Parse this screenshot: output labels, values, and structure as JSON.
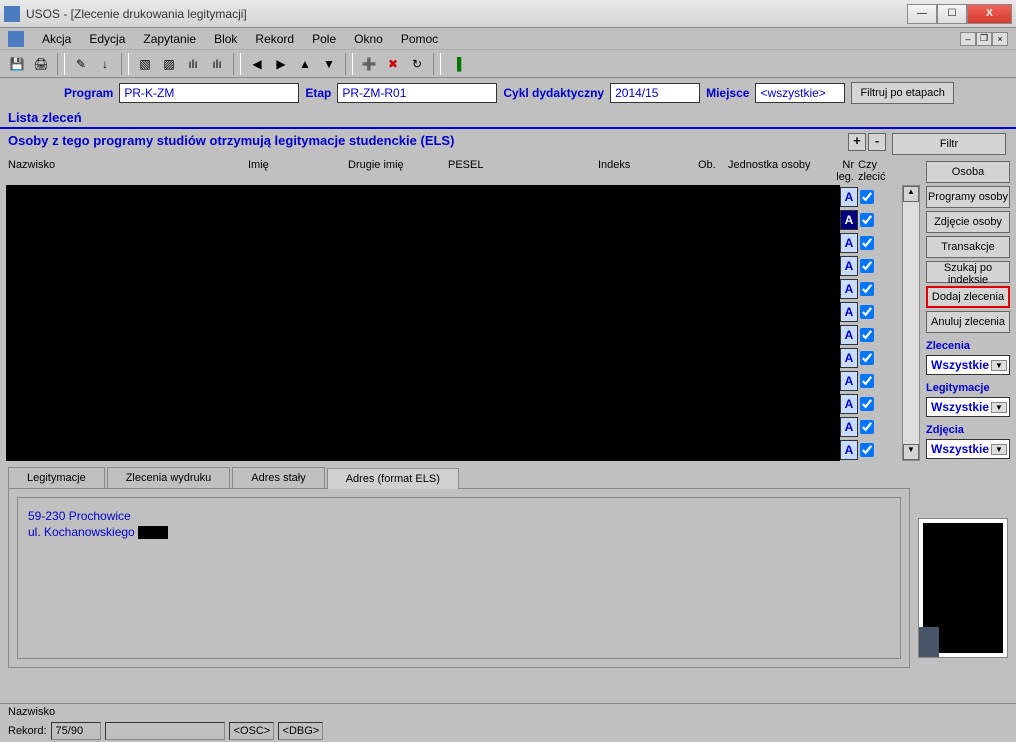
{
  "window": {
    "title": "USOS - [Zlecenie drukowania legitymacji]"
  },
  "menu": {
    "items": [
      "Akcja",
      "Edycja",
      "Zapytanie",
      "Blok",
      "Rekord",
      "Pole",
      "Okno",
      "Pomoc"
    ]
  },
  "filters": {
    "program_label": "Program",
    "program_value": "PR-K-ZM",
    "etap_label": "Etap",
    "etap_value": "PR-ZM-R01",
    "cykl_label": "Cykl dydaktyczny",
    "cykl_value": "2014/15",
    "miejsce_label": "Miejsce",
    "miejsce_value": "<wszystkie>",
    "filter_btn": "Filtruj po etapach"
  },
  "sections": {
    "lista_zlecen": "Lista zleceń",
    "osoby_subtitle": "Osoby z tego programy studiów otrzymują legitymacje studenckie (ELS)"
  },
  "columns": {
    "nazwisko": "Nazwisko",
    "imie": "Imię",
    "drugie_imie": "Drugie imię",
    "pesel": "PESEL",
    "indeks": "Indeks",
    "ob": "Ob.",
    "jednostka": "Jednostka osoby",
    "nr_leg": "Nr leg.",
    "czy_zlecic": "Czy zlecić"
  },
  "grid": {
    "rows": [
      {
        "a": "A",
        "checked": true,
        "selected": false
      },
      {
        "a": "A",
        "checked": true,
        "selected": true
      },
      {
        "a": "A",
        "checked": true,
        "selected": false
      },
      {
        "a": "A",
        "checked": true,
        "selected": false
      },
      {
        "a": "A",
        "checked": true,
        "selected": false
      },
      {
        "a": "A",
        "checked": true,
        "selected": false
      },
      {
        "a": "A",
        "checked": true,
        "selected": false
      },
      {
        "a": "A",
        "checked": true,
        "selected": false
      },
      {
        "a": "A",
        "checked": true,
        "selected": false
      },
      {
        "a": "A",
        "checked": true,
        "selected": false
      },
      {
        "a": "A",
        "checked": true,
        "selected": false
      },
      {
        "a": "A",
        "checked": true,
        "selected": false
      }
    ]
  },
  "side_buttons": {
    "filtr": "Filtr",
    "osoba": "Osoba",
    "programy_osoby": "Programy osoby",
    "zdjecie_osoby": "Zdjęcie osoby",
    "transakcje": "Transakcje",
    "szukaj_po_indeksie": "Szukaj po indeksie",
    "dodaj_zlecenia": "Dodaj zlecenia",
    "anuluj_zlecenia": "Anuluj zlecenia"
  },
  "side_selects": {
    "zlecenia_label": "Zlecenia",
    "zlecenia_value": "Wszystkie",
    "legitymacje_label": "Legitymacje",
    "legitymacje_value": "Wszystkie",
    "zdjecia_label": "Zdjęcia",
    "zdjecia_value": "Wszystkie"
  },
  "tabs": {
    "items": [
      "Legitymacje",
      "Zlecenia wydruku",
      "Adres stały",
      "Adres (format ELS)"
    ],
    "active": 3
  },
  "address": {
    "line1": "59-230 Prochowice",
    "line2": "ul. Kochanowskiego "
  },
  "status": {
    "nazwisko_label": "Nazwisko",
    "rekord_label": "Rekord:",
    "rekord_value": "75/90",
    "osc": "<OSC>",
    "dbg": "<DBG>"
  }
}
